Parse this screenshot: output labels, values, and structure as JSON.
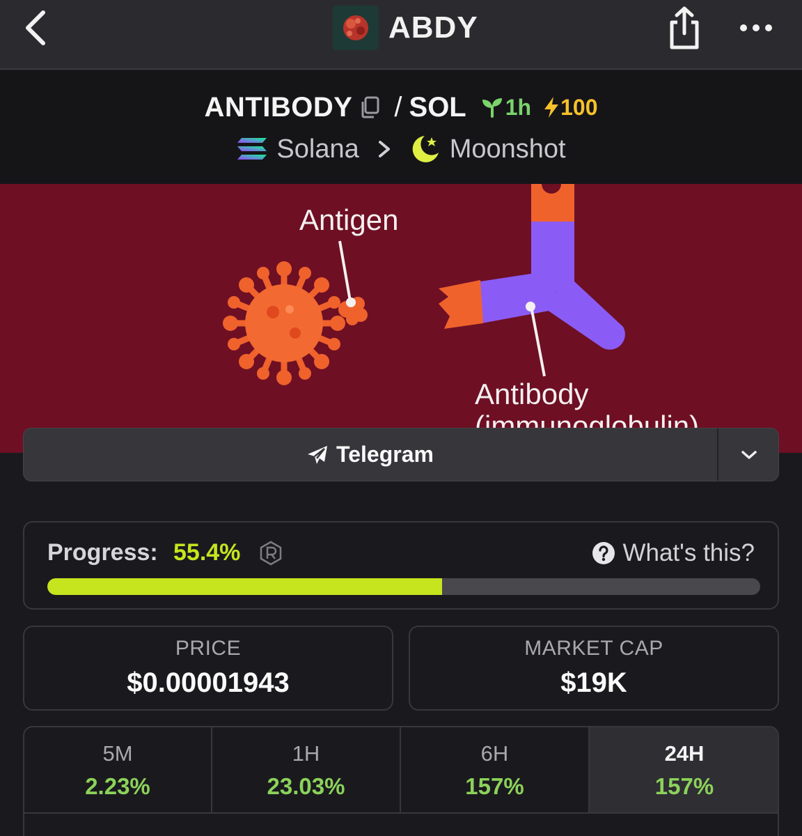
{
  "nav": {
    "title": "ABDY",
    "back_icon": "chevron-left-icon",
    "share_icon": "share-icon",
    "more_icon": "more-horizontal-icon"
  },
  "pair": {
    "base": "ANTIBODY",
    "separator": "/",
    "quote": "SOL",
    "age": "1h",
    "boost": "100",
    "chain": "Solana",
    "dex": "Moonshot",
    "age_color": "#7bd36c",
    "boost_color": "#f6c12a"
  },
  "banner": {
    "label_antigen": "Antigen",
    "label_antibody": "Antibody",
    "label_sub": "(immunoglobulin)",
    "background": "#6e0f24"
  },
  "telegram": {
    "label": "Telegram"
  },
  "progress": {
    "label": "Progress:",
    "value": "55.4%",
    "fraction": 0.554,
    "help": "What's this?",
    "accent": "#c6e51f"
  },
  "stats": {
    "price_label": "PRICE",
    "price_value": "$0.00001943",
    "mcap_label": "MARKET CAP",
    "mcap_value": "$19K"
  },
  "timeframes": [
    {
      "label": "5M",
      "value": "2.23%"
    },
    {
      "label": "1H",
      "value": "23.03%"
    },
    {
      "label": "6H",
      "value": "157%"
    },
    {
      "label": "24H",
      "value": "157%",
      "active": true
    }
  ],
  "colors": {
    "positive": "#8cd25a"
  }
}
